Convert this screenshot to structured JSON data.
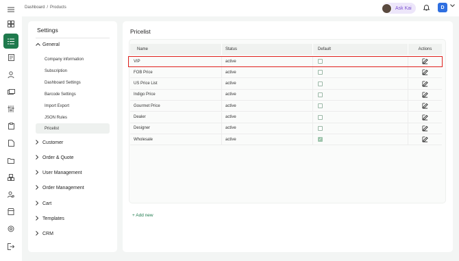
{
  "breadcrumb": {
    "parent": "Dashboard",
    "separator": "/",
    "current": "Products"
  },
  "header": {
    "ask_label": "Ask Kai",
    "user_initial": "D"
  },
  "settings": {
    "title": "Settings",
    "general": {
      "label": "General",
      "items": [
        "Company information",
        "Subscription",
        "Dashboard Settings",
        "Barcode Settings",
        "Import Export",
        "JSON Rules",
        "Pricelist"
      ]
    },
    "sections": [
      "Customer",
      "Order & Quote",
      "User Management",
      "Order Management",
      "Cart",
      "Templates",
      "CRM"
    ]
  },
  "main": {
    "title": "Pricelist",
    "columns": [
      "Name",
      "Status",
      "Default",
      "Actions"
    ],
    "rows": [
      {
        "name": "VIP",
        "status": "active",
        "default": false
      },
      {
        "name": "FOB Price",
        "status": "active",
        "default": false
      },
      {
        "name": "US Price List",
        "status": "active",
        "default": false
      },
      {
        "name": "Indigo Price",
        "status": "active",
        "default": false
      },
      {
        "name": "Gourmet Price",
        "status": "active",
        "default": false
      },
      {
        "name": "Dealer",
        "status": "active",
        "default": false
      },
      {
        "name": "Designer",
        "status": "active",
        "default": false
      },
      {
        "name": "Wholesale",
        "status": "active",
        "default": true
      }
    ],
    "add_new": "+ Add new"
  },
  "colors": {
    "accent": "#1f7a4d",
    "highlight": "#e0201c",
    "ask_kai": "#7a4fd0",
    "avatar": "#2f6fe0"
  }
}
